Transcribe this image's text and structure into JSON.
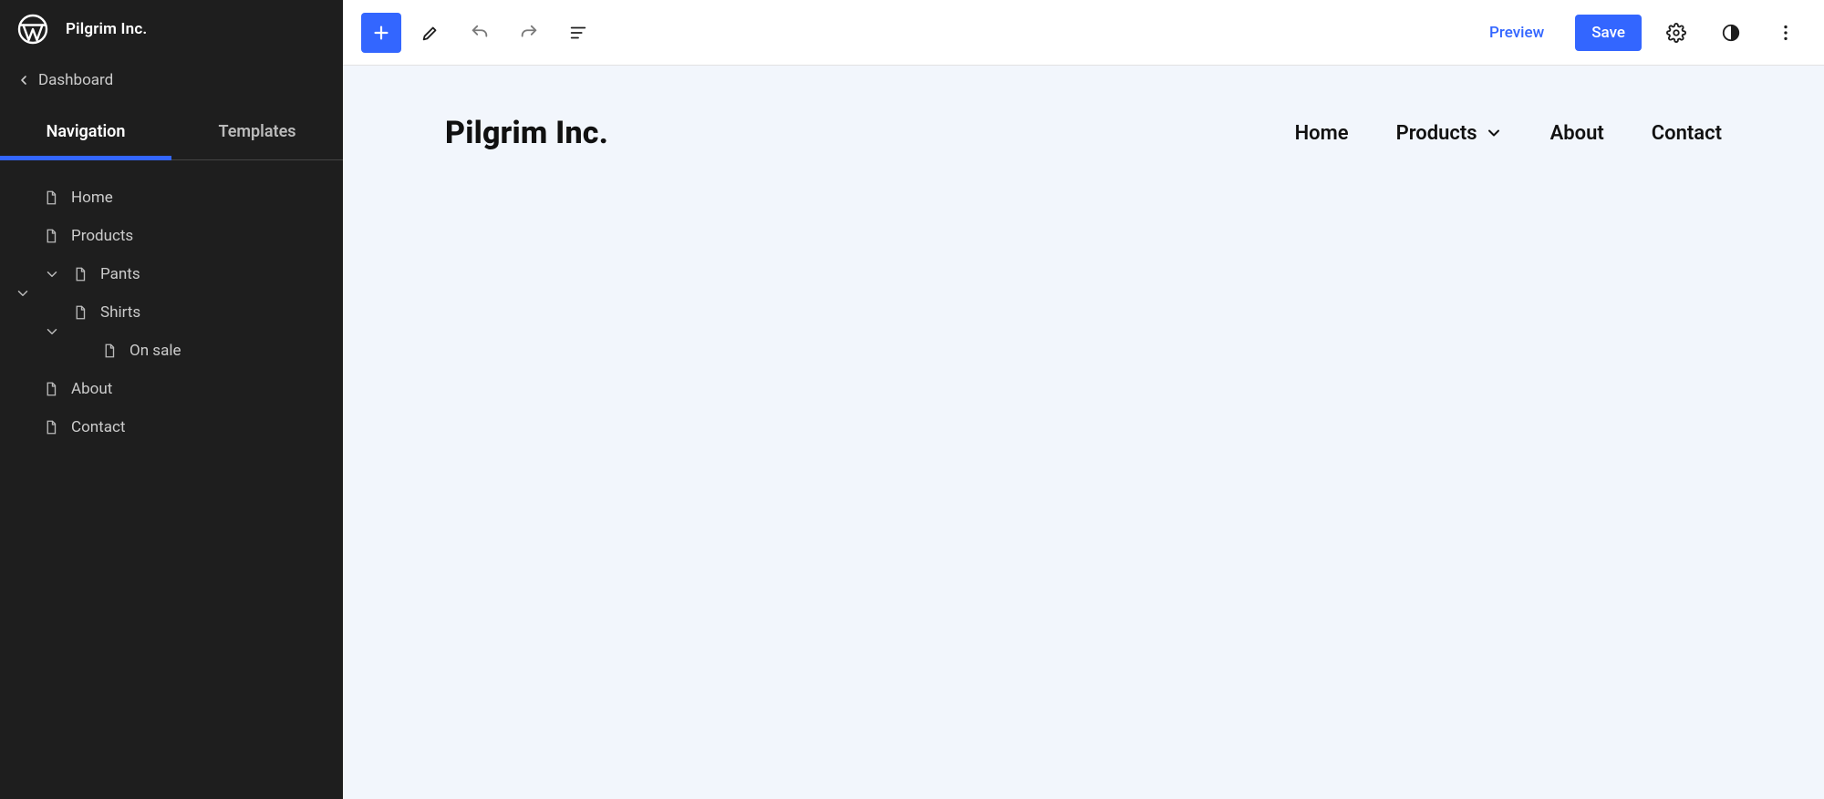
{
  "site": {
    "name": "Pilgrim Inc."
  },
  "sidebar": {
    "back_label": "Dashboard",
    "tabs": {
      "navigation": "Navigation",
      "templates": "Templates"
    },
    "tree": {
      "home": "Home",
      "products": "Products",
      "pants": "Pants",
      "shirts": "Shirts",
      "on_sale": "On sale",
      "about": "About",
      "contact": "Contact"
    }
  },
  "toolbar": {
    "preview_label": "Preview",
    "save_label": "Save"
  },
  "canvas": {
    "site_title": "Pilgrim Inc.",
    "nav": {
      "home": "Home",
      "products": "Products",
      "about": "About",
      "contact": "Contact"
    }
  }
}
